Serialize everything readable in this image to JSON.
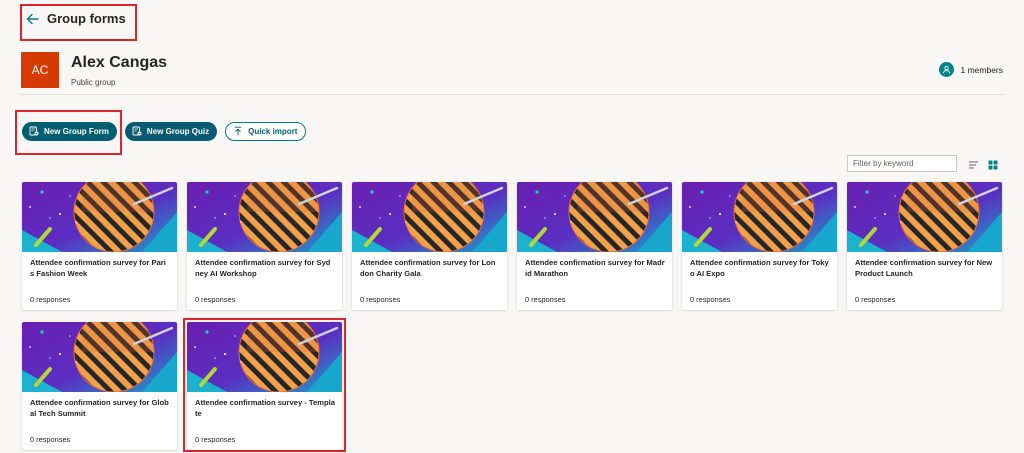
{
  "topbar": {
    "title": "Group forms"
  },
  "group": {
    "initials": "AC",
    "name": "Alex Cangas",
    "type": "Public group",
    "members": "1 members"
  },
  "actions": {
    "new_form": "New Group Form",
    "new_quiz": "New Group Quiz",
    "quick_import": "Quick import"
  },
  "filter": {
    "placeholder": "Filter by keyword"
  },
  "colors": {
    "accent": "#035e72",
    "avatar": "#d83b01",
    "members_icon": "#038387",
    "annotation": "#d9262c"
  },
  "forms": [
    {
      "title": "Attendee confirmation survey for Paris Fashion Week",
      "responses": "0 responses"
    },
    {
      "title": "Attendee confirmation survey for Sydney AI Workshop",
      "responses": "0 responses"
    },
    {
      "title": "Attendee confirmation survey for London Charity Gala",
      "responses": "0 responses"
    },
    {
      "title": "Attendee confirmation survey for Madrid Marathon",
      "responses": "0 responses"
    },
    {
      "title": "Attendee confirmation survey for Tokyo AI Expo",
      "responses": "0 responses"
    },
    {
      "title": "Attendee confirmation survey for New Product Launch",
      "responses": "0 responses"
    },
    {
      "title": "Attendee confirmation survey for Global Tech Summit",
      "responses": "0 responses"
    },
    {
      "title": "Attendee confirmation survey - Template",
      "responses": "0 responses"
    }
  ]
}
